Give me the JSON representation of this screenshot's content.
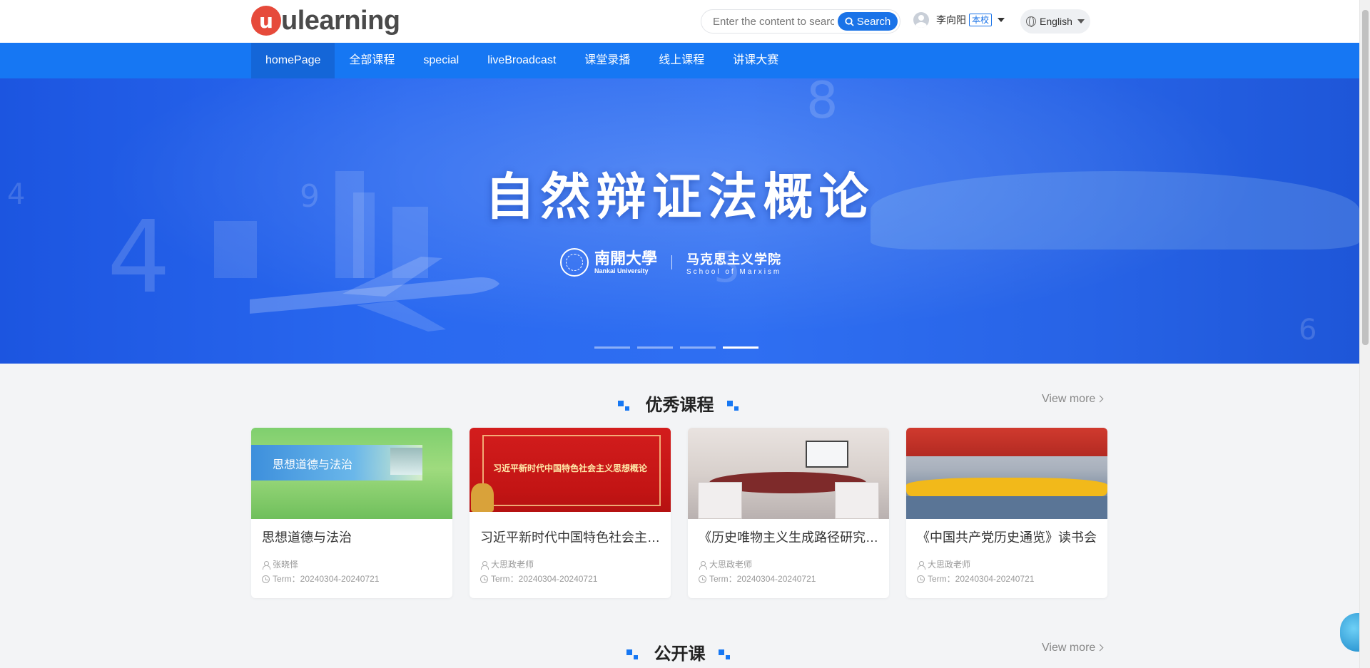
{
  "header": {
    "logo_letter": "u",
    "logo_text": "ulearning",
    "search": {
      "placeholder": "Enter the content to search",
      "button_label": "Search"
    },
    "user": {
      "name": "李向阳",
      "badge": "本校"
    },
    "language": "English"
  },
  "nav": {
    "items": [
      {
        "label": "homePage",
        "active": true
      },
      {
        "label": "全部课程"
      },
      {
        "label": "special"
      },
      {
        "label": "liveBroadcast"
      },
      {
        "label": "课堂录播"
      },
      {
        "label": "线上课程"
      },
      {
        "label": "讲课大赛"
      }
    ]
  },
  "banner": {
    "title": "自然辩证法概论",
    "university_cn": "南開大學",
    "university_en": "Nankai University",
    "school_cn": "马克思主义学院",
    "school_en": "School of Marxism",
    "slides": 4,
    "active_slide": 4
  },
  "sections": [
    {
      "title": "优秀课程",
      "view_more": "View more",
      "courses": [
        {
          "title": "思想道德与法治",
          "thumb_text": "思想道德与法治",
          "teacher": "张晓怿",
          "term": "Term：20240304-20240721"
        },
        {
          "title": "习近平新时代中国特色社会主义思想概论",
          "thumb_text": "习近平新时代中国特色社会主义思想概论",
          "teacher": "大思政老师",
          "term": "Term：20240304-20240721"
        },
        {
          "title": "《历史唯物主义生成路径研究》读书会",
          "teacher": "大思政老师",
          "term": "Term：20240304-20240721"
        },
        {
          "title": "《中国共产党历史通览》读书会",
          "teacher": "大思政老师",
          "term": "Term：20240304-20240721"
        }
      ]
    },
    {
      "title": "公开课",
      "view_more": "View more"
    }
  ],
  "colors": {
    "primary": "#1677f3",
    "logo_red": "#e64a3b"
  }
}
